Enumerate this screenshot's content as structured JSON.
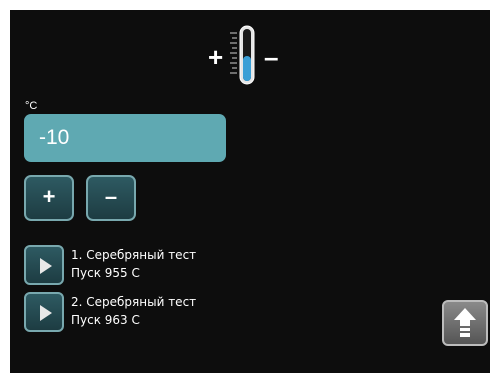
{
  "header": {
    "plus": "+",
    "minus": "–",
    "icon": "thermometer-icon"
  },
  "temperature": {
    "unit": "°C",
    "value": "-10"
  },
  "controls": {
    "increase": "+",
    "decrease": "–"
  },
  "tests": [
    {
      "title": "1. Серебряный тест",
      "subtitle": "Пуск 955  C"
    },
    {
      "title": "2. Серебряный тест",
      "subtitle": "Пуск 963  C"
    }
  ],
  "icons": {
    "play": "play-icon",
    "home": "arrow-up-icon"
  },
  "colors": {
    "field": "#5fa9b2",
    "button": "#2e5a62",
    "thermometer_fill": "#3a9fd6"
  }
}
